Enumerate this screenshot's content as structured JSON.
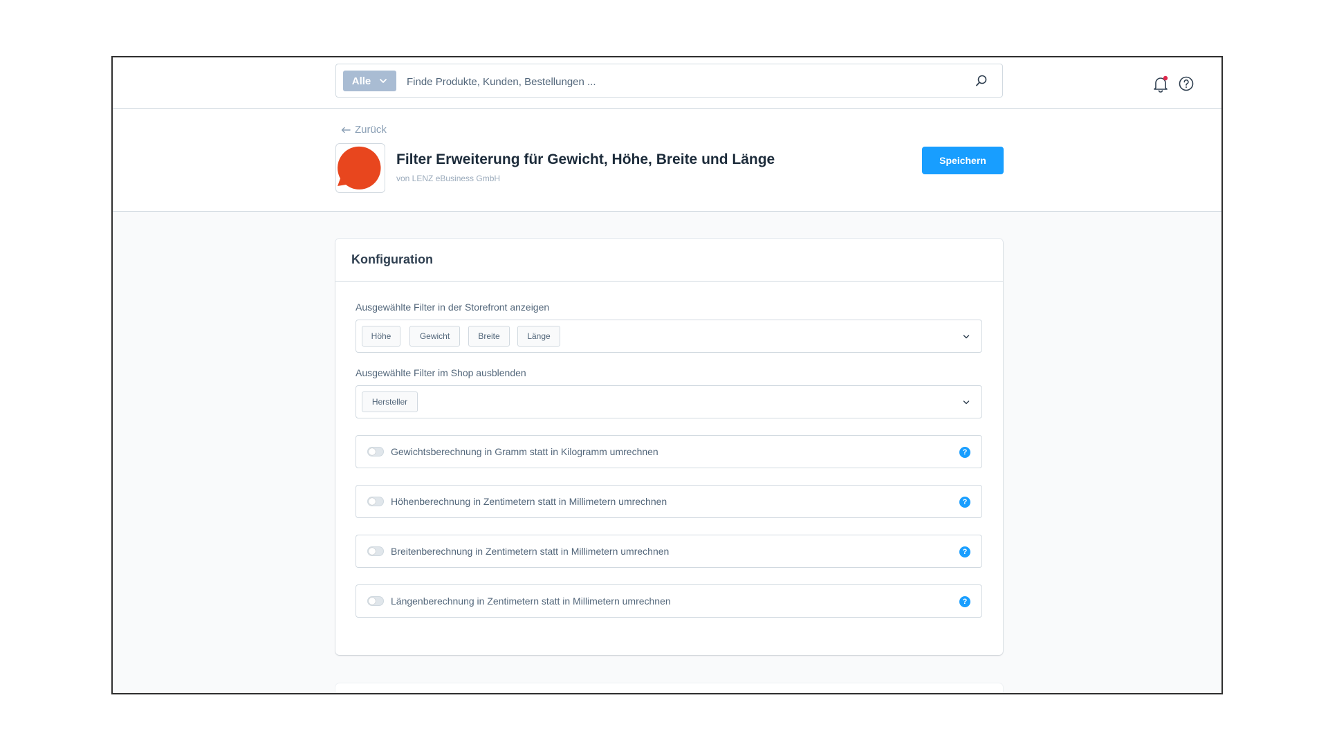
{
  "topbar": {
    "search_type": "Alle",
    "search_placeholder": "Finde Produkte, Kunden, Bestellungen ..."
  },
  "header": {
    "back_label": "Zurück",
    "title": "Filter Erweiterung für Gewicht, Höhe, Breite und Länge",
    "author": "von LENZ eBusiness GmbH",
    "save_label": "Speichern",
    "logo_color": "#e8461e"
  },
  "config": {
    "title": "Konfiguration",
    "show_filters": {
      "label": "Ausgewählte Filter in der Storefront anzeigen",
      "tags": [
        "Höhe",
        "Gewicht",
        "Breite",
        "Länge"
      ]
    },
    "hide_filters": {
      "label": "Ausgewählte Filter im Shop ausblenden",
      "tags": [
        "Hersteller"
      ]
    },
    "switches": [
      {
        "label": "Gewichtsberechnung in Gramm statt in Kilogramm umrechnen",
        "checked": false
      },
      {
        "label": "Höhenberechnung in Zentimetern statt in Millimetern umrechnen",
        "checked": false
      },
      {
        "label": "Breitenberechnung in Zentimetern statt in Millimetern umrechnen",
        "checked": false
      },
      {
        "label": "Längenberechnung in Zentimetern statt in Millimetern umrechnen",
        "checked": false
      }
    ],
    "help_glyph": "?"
  },
  "colors": {
    "accent": "#189eff",
    "search_type_bg": "#a9bcd3",
    "notification_dot": "#de294c"
  }
}
